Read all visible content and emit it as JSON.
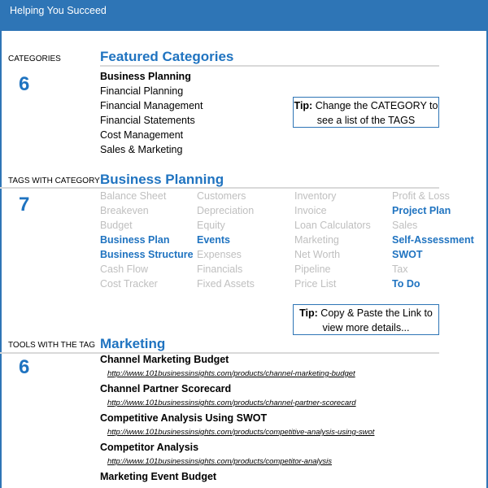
{
  "header": {
    "title": "Helping You Succeed",
    "color": "#2E75B6"
  },
  "accent_color": "#1F73C0",
  "categories": {
    "label": "CATEGORIES",
    "title": "Featured Categories",
    "count": "6",
    "items": [
      {
        "label": "Business Planning",
        "selected": true
      },
      {
        "label": "Financial Planning",
        "selected": false
      },
      {
        "label": "Financial Management",
        "selected": false
      },
      {
        "label": "Financial Statements",
        "selected": false
      },
      {
        "label": "Cost Management",
        "selected": false
      },
      {
        "label": "Sales & Marketing",
        "selected": false
      }
    ],
    "tip": {
      "bold": "Tip:",
      "text": " Change the CATEGORY to see a list of the TAGS"
    }
  },
  "tags": {
    "label": "TAGS WITH CATEGORY",
    "title": "Business Planning",
    "count": "7",
    "columns": [
      [
        {
          "label": "Balance Sheet",
          "active": false
        },
        {
          "label": "Breakeven",
          "active": false
        },
        {
          "label": "Budget",
          "active": false
        },
        {
          "label": "Business Plan",
          "active": true
        },
        {
          "label": "Business Structure",
          "active": true
        },
        {
          "label": "Cash Flow",
          "active": false
        },
        {
          "label": "Cost Tracker",
          "active": false
        }
      ],
      [
        {
          "label": "Customers",
          "active": false
        },
        {
          "label": "Depreciation",
          "active": false
        },
        {
          "label": "Equity",
          "active": false
        },
        {
          "label": "Events",
          "active": true
        },
        {
          "label": "Expenses",
          "active": false
        },
        {
          "label": "Financials",
          "active": false
        },
        {
          "label": "Fixed Assets",
          "active": false
        }
      ],
      [
        {
          "label": "Inventory",
          "active": false
        },
        {
          "label": "Invoice",
          "active": false
        },
        {
          "label": "Loan Calculators",
          "active": false
        },
        {
          "label": "Marketing",
          "active": false
        },
        {
          "label": "Net Worth",
          "active": false
        },
        {
          "label": "Pipeline",
          "active": false
        },
        {
          "label": "Price List",
          "active": false
        }
      ],
      [
        {
          "label": "Profit & Loss",
          "active": false
        },
        {
          "label": "Project Plan",
          "active": true
        },
        {
          "label": "Sales",
          "active": false
        },
        {
          "label": "Self-Assessment",
          "active": true
        },
        {
          "label": "SWOT",
          "active": true
        },
        {
          "label": "Tax",
          "active": false
        },
        {
          "label": "To Do",
          "active": true
        }
      ]
    ],
    "tip": {
      "bold": "Tip:",
      "text": " Copy & Paste the Link to view more details..."
    }
  },
  "tools": {
    "label": "TOOLS WITH THE TAG",
    "title": "Marketing",
    "count": "6",
    "items": [
      {
        "name": "Channel Marketing Budget",
        "link": "http://www.101businessinsights.com/products/channel-marketing-budget"
      },
      {
        "name": "Channel Partner Scorecard",
        "link": "http://www.101businessinsights.com/products/channel-partner-scorecard"
      },
      {
        "name": "Competitive Analysis Using SWOT",
        "link": "http://www.101businessinsights.com/products/competitive-analysis-using-swot"
      },
      {
        "name": "Competitor Analysis",
        "link": "http://www.101businessinsights.com/products/competitor-analysis"
      },
      {
        "name": "Marketing Event Budget",
        "link": ""
      }
    ]
  }
}
